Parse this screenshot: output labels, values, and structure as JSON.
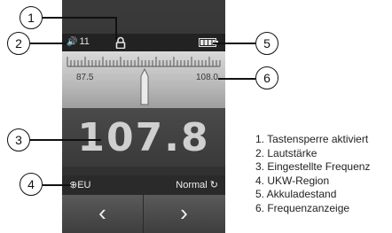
{
  "status": {
    "volume": "11"
  },
  "tuner": {
    "low": "87.5",
    "high": "108.0"
  },
  "frequency": "107.8",
  "region": {
    "left": "EU",
    "right": "Normal"
  },
  "nav": {
    "prev": "‹",
    "next": "›"
  },
  "callouts": [
    "1",
    "2",
    "3",
    "4",
    "5",
    "6"
  ],
  "legend": [
    "1. Tastensperre aktiviert",
    "2. Lautstärke",
    "3. Eingestellte Frequenz",
    "4. UKW-Region",
    "5. Akkuladestand",
    "6. Frequenzanzeige"
  ]
}
